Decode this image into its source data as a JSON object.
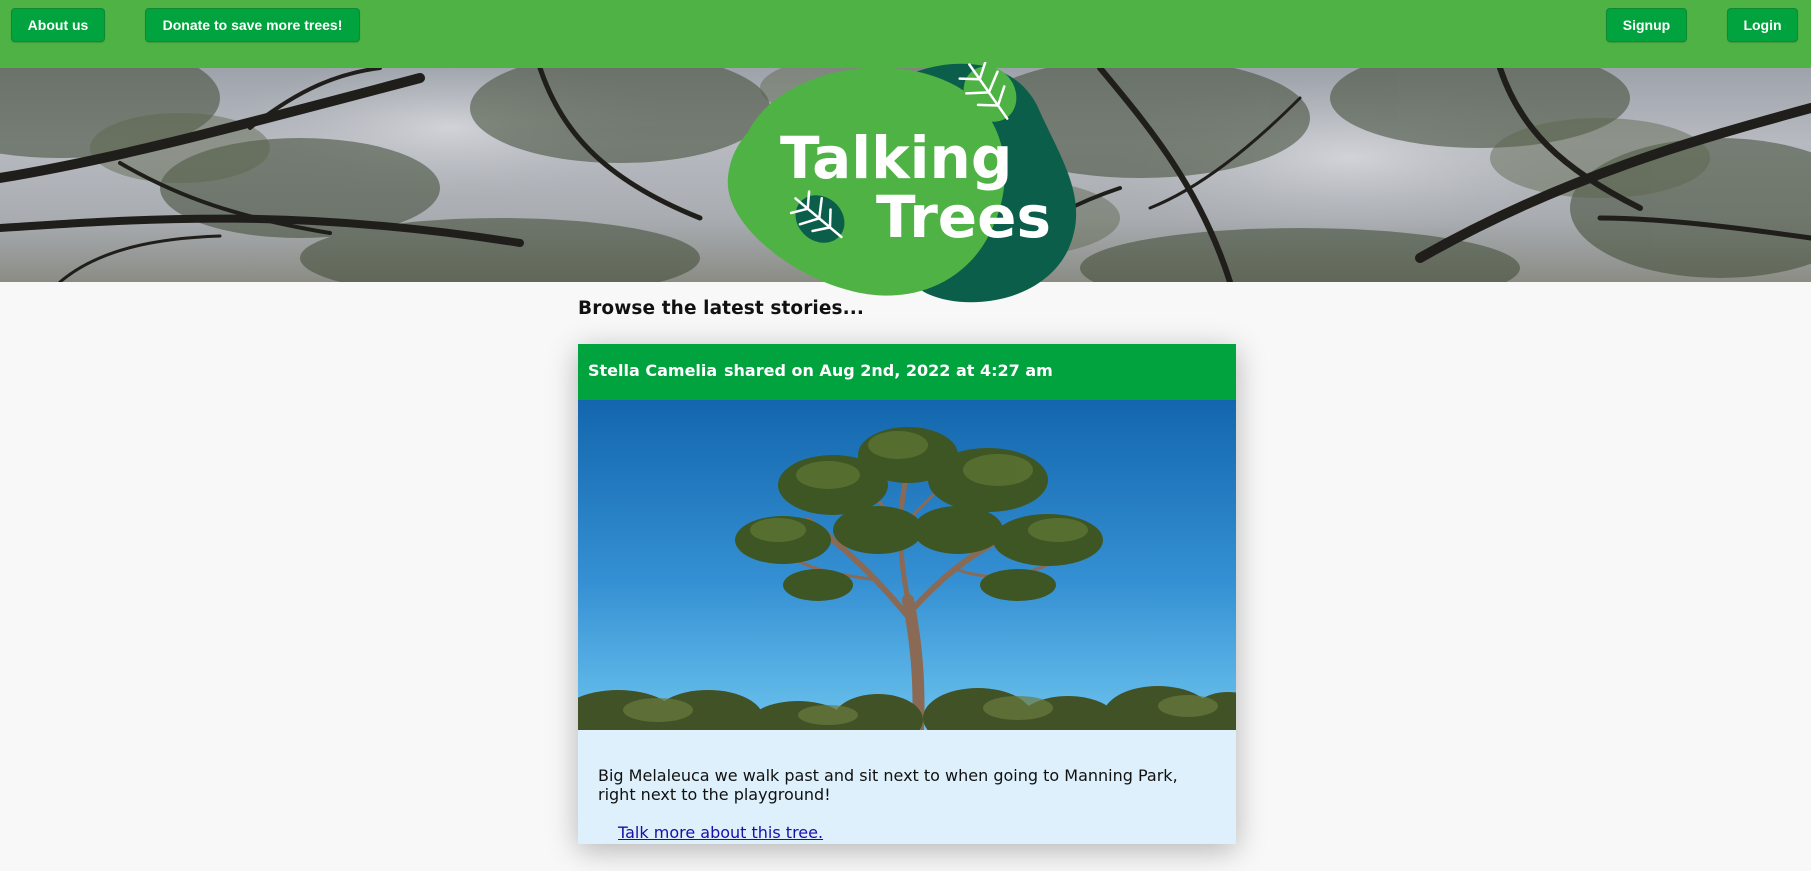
{
  "nav": {
    "about_label": "About us",
    "donate_label": "Donate to save more trees!",
    "signup_label": "Signup",
    "login_label": "Login"
  },
  "brand": {
    "name": "Talking Trees",
    "line1": "Talking",
    "line2": "Trees",
    "logo_icon": "leaf-icon",
    "colors": {
      "light_green": "#4fb244",
      "dark_green": "#0b5e4a",
      "button_green": "#00a33d",
      "card_bg": "#ddf0fb",
      "link": "#1a0dab"
    }
  },
  "main": {
    "section_title": "Browse the latest stories..."
  },
  "stories": [
    {
      "author": "Stella Camelia",
      "shared_text": "shared on Aug 2nd, 2022 at 4:27 am",
      "description": "Big Melaleuca we walk past and sit next to when going to Manning Park, right next to the playground!",
      "link_text": "Talk more about this tree."
    }
  ]
}
